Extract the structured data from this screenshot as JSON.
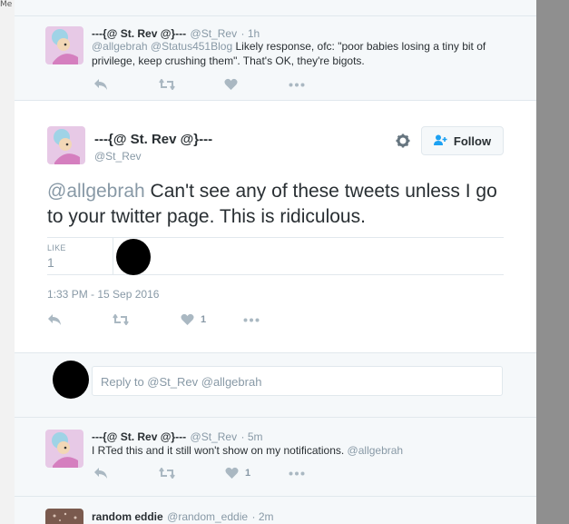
{
  "left_fragment": "Me",
  "reply_prev": {
    "name": "---{@ St. Rev @}---",
    "handle": "@St_Rev",
    "time": "· 1h",
    "mentions": "@allgebrah @Status451Blog",
    "text": "Likely response, ofc: \"poor babies losing a tiny bit of privilege, keep crushing them\". That's OK, they're bigots."
  },
  "main": {
    "name": "---{@ St. Rev @}---",
    "handle": "@St_Rev",
    "follow_label": "Follow",
    "mention": "@allgebrah",
    "text": " Can't see any of these tweets unless I go to your twitter page. This is ridiculous.",
    "likes_label": "LIKE",
    "likes_count": "1",
    "timestamp": "1:33 PM - 15 Sep 2016",
    "like_action_count": "1"
  },
  "reply_box": {
    "placeholder": "Reply to @St_Rev @allgebrah"
  },
  "reply_next": {
    "name": "---{@ St. Rev @}---",
    "handle": "@St_Rev",
    "time": "· 5m",
    "text": "I RTed this and it still won't show on my notifications.",
    "mention": "@allgebrah",
    "like_count": "1"
  },
  "reply_last": {
    "name": "random eddie",
    "handle": "@random_eddie",
    "time": "· 2m"
  },
  "colors": {
    "link_muted": "#8899a6",
    "icon": "#aab8c2",
    "text": "#292f33",
    "border": "#e1e8ed"
  }
}
